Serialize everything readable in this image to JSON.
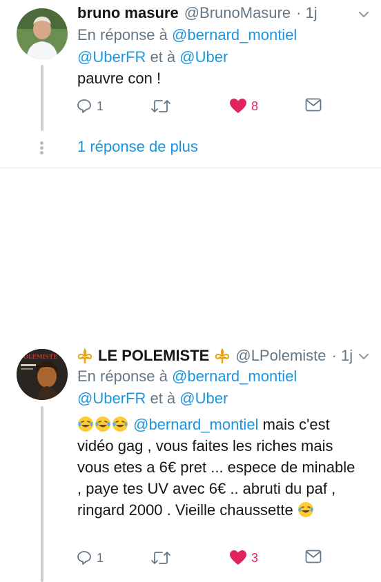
{
  "tweets": [
    {
      "name": "bruno masure",
      "handle": "@BrunoMasure",
      "time": "· 1j",
      "reply_prefix": "En réponse à",
      "reply_to_1": "@bernard_montiel",
      "reply_to_2": "@UberFR",
      "reply_and": "et à",
      "reply_to_3": "@Uber",
      "text": "pauvre con !",
      "reply_count": "1",
      "like_count": "8",
      "more_replies": "1 réponse de plus"
    },
    {
      "name": "LE POLEMISTE",
      "handle": "@LPolemiste",
      "time": "· 1j",
      "reply_prefix": "En réponse à",
      "reply_to_1": "@bernard_montiel",
      "reply_to_2": "@UberFR",
      "reply_and": "et à",
      "reply_to_3": "@Uber",
      "text_mention": "@bernard_montiel",
      "text_body": "mais c'est vidéo gag , vous faites les riches mais vous etes a 6€ pret ... espece de minable , paye tes UV avec 6€ .. abruti du paf , ringard 2000 . Vieille chaussette",
      "reply_count": "1",
      "like_count": "3",
      "avatar_text": "POLEMISTE"
    }
  ],
  "colors": {
    "link": "#1b95e0",
    "like": "#e0245e",
    "muted": "#657786"
  },
  "icons": [
    "reply-icon",
    "retweet-icon",
    "heart-icon",
    "message-icon",
    "chevron-down-icon",
    "fleur-de-lis-icon",
    "laughing-emoji"
  ]
}
